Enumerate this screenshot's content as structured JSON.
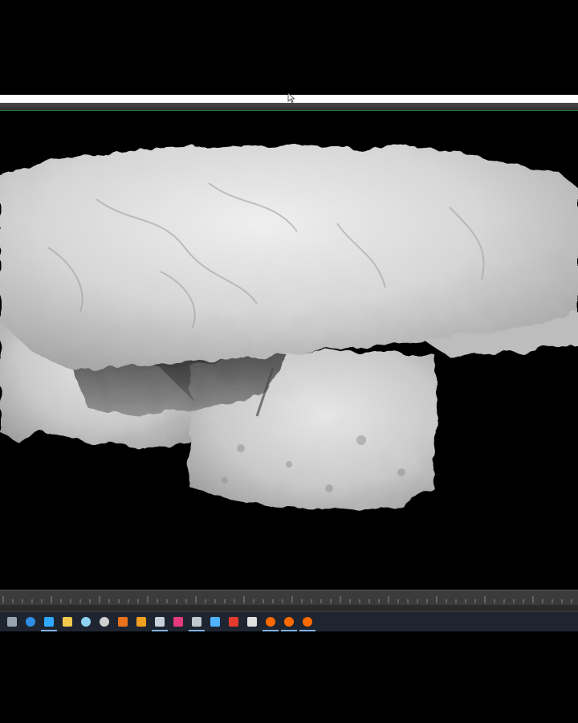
{
  "window": {
    "viewport_background": "#000000",
    "title_bar_color": "#ffffff",
    "toolbar_accent": "#2c7a2c"
  },
  "viewport": {
    "model": "3d-scanned-rock-sculpt",
    "model_color": "#d9d9d9"
  },
  "timeline": {
    "background": "#3b3b3b"
  },
  "taskbar": {
    "background": "#1e2530",
    "icons": [
      {
        "name": "task-view-icon",
        "color": "#9aa4b0",
        "active": false
      },
      {
        "name": "edge-browser-icon",
        "color": "#2f8de4",
        "active": false
      },
      {
        "name": "photoshop-icon",
        "color": "#31a8ff",
        "active": true
      },
      {
        "name": "file-explorer-icon",
        "color": "#f2c94c",
        "active": false
      },
      {
        "name": "notepad-icon",
        "color": "#8fd3f4",
        "active": false
      },
      {
        "name": "obs-icon",
        "color": "#d0d0d0",
        "active": false
      },
      {
        "name": "app-orange-icon",
        "color": "#e8731a",
        "active": false
      },
      {
        "name": "app-yellow-icon",
        "color": "#f0a020",
        "active": false
      },
      {
        "name": "zbrush-icon",
        "color": "#c9d2dc",
        "active": true
      },
      {
        "name": "maya-icon",
        "color": "#e43b7c",
        "active": false
      },
      {
        "name": "meshlab-icon",
        "color": "#c0c8d0",
        "active": true
      },
      {
        "name": "app-blue-icon",
        "color": "#4fb3ff",
        "active": false
      },
      {
        "name": "acrobat-icon",
        "color": "#e23b2e",
        "active": false
      },
      {
        "name": "brush-tool-icon",
        "color": "#e0e0e0",
        "active": false
      },
      {
        "name": "houdini-icon-1",
        "color": "#ff6a00",
        "active": true
      },
      {
        "name": "houdini-icon-2",
        "color": "#ff6a00",
        "active": true
      },
      {
        "name": "houdini-icon-3",
        "color": "#ff6a00",
        "active": true
      }
    ]
  }
}
